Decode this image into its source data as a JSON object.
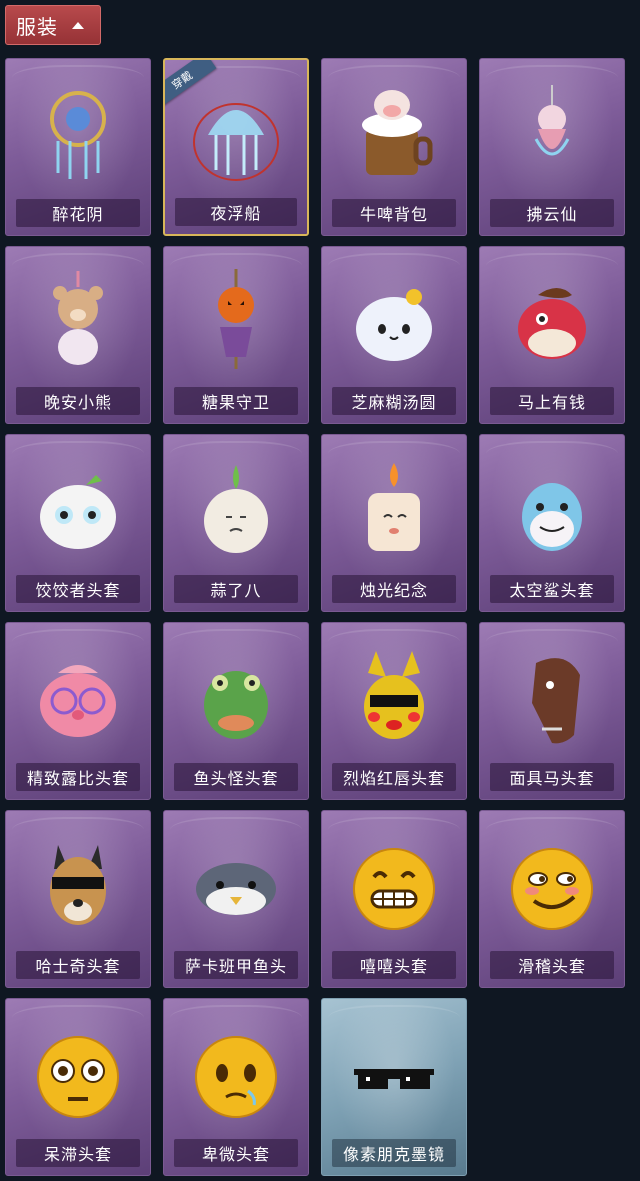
{
  "header": {
    "title": "服装",
    "chevron_icon": "chevron-up-icon"
  },
  "equipped_badge": "穿戴",
  "items": [
    {
      "label": "醉花阴",
      "icon": "dreamcatcher-pendant-icon",
      "equipped": false,
      "variant": "purple"
    },
    {
      "label": "夜浮船",
      "icon": "jellyfish-pendant-icon",
      "equipped": true,
      "variant": "purple"
    },
    {
      "label": "牛啤背包",
      "icon": "cow-beer-mug-icon",
      "equipped": false,
      "variant": "purple"
    },
    {
      "label": "拂云仙",
      "icon": "cloud-fairy-pendant-icon",
      "equipped": false,
      "variant": "purple"
    },
    {
      "label": "晚安小熊",
      "icon": "teddy-bear-pendant-icon",
      "equipped": false,
      "variant": "purple"
    },
    {
      "label": "糖果守卫",
      "icon": "pumpkin-scarecrow-icon",
      "equipped": false,
      "variant": "purple"
    },
    {
      "label": "芝麻糊汤圆",
      "icon": "rice-ball-icon",
      "equipped": false,
      "variant": "purple"
    },
    {
      "label": "马上有钱",
      "icon": "red-horse-icon",
      "equipped": false,
      "variant": "purple"
    },
    {
      "label": "饺饺者头套",
      "icon": "dumpling-head-icon",
      "equipped": false,
      "variant": "purple"
    },
    {
      "label": "蒜了八",
      "icon": "garlic-head-icon",
      "equipped": false,
      "variant": "purple"
    },
    {
      "label": "烛光纪念",
      "icon": "candle-head-icon",
      "equipped": false,
      "variant": "purple"
    },
    {
      "label": "太空鲨头套",
      "icon": "shark-head-icon",
      "equipped": false,
      "variant": "purple"
    },
    {
      "label": "精致露比头套",
      "icon": "pink-glasses-head-icon",
      "equipped": false,
      "variant": "purple"
    },
    {
      "label": "鱼头怪头套",
      "icon": "fish-monster-head-icon",
      "equipped": false,
      "variant": "purple"
    },
    {
      "label": "烈焰红唇头套",
      "icon": "yellow-sunglasses-head-icon",
      "equipped": false,
      "variant": "purple"
    },
    {
      "label": "面具马头套",
      "icon": "horse-mask-icon",
      "equipped": false,
      "variant": "purple"
    },
    {
      "label": "哈士奇头套",
      "icon": "husky-head-icon",
      "equipped": false,
      "variant": "purple"
    },
    {
      "label": "萨卡班甲鱼头",
      "icon": "fish-head-icon",
      "equipped": false,
      "variant": "purple"
    },
    {
      "label": "嘻嘻头套",
      "icon": "grin-emoji-icon",
      "equipped": false,
      "variant": "purple"
    },
    {
      "label": "滑稽头套",
      "icon": "smirk-emoji-icon",
      "equipped": false,
      "variant": "purple"
    },
    {
      "label": "呆滞头套",
      "icon": "flushed-emoji-icon",
      "equipped": false,
      "variant": "purple"
    },
    {
      "label": "卑微头套",
      "icon": "pleading-emoji-icon",
      "equipped": false,
      "variant": "purple"
    },
    {
      "label": "像素朋克墨镜",
      "icon": "pixel-sunglasses-icon",
      "equipped": false,
      "variant": "blue"
    }
  ]
}
